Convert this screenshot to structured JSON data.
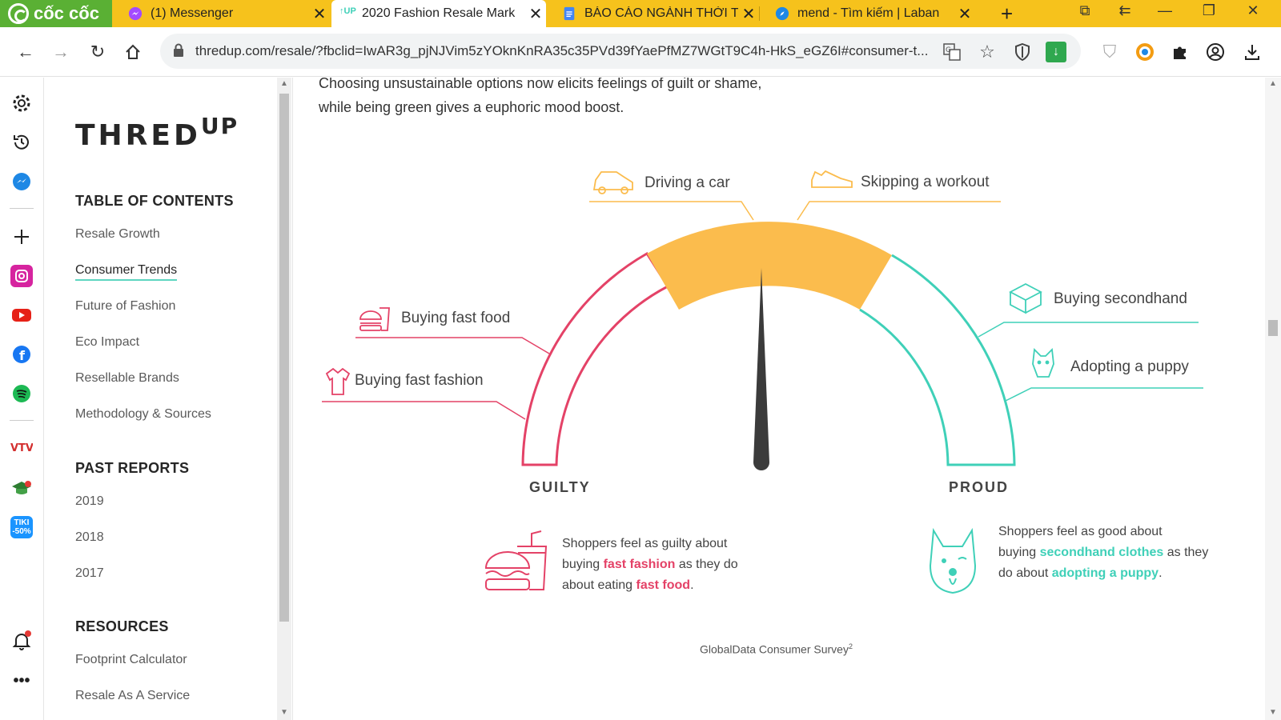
{
  "browser": {
    "brand": "cốc cốc",
    "tabs": [
      {
        "title": "(1) Messenger",
        "icon": "messenger-icon"
      },
      {
        "title": "2020 Fashion Resale Mark",
        "icon": "thredup-icon"
      },
      {
        "title": "BÁO CÁO NGÀNH THỜI T",
        "icon": "google-docs-icon"
      },
      {
        "title": "mend - Tìm kiếm | Laban",
        "icon": "compass-icon"
      }
    ],
    "url": "thredup.com/resale/?fbclid=IwAR3g_pjNJVim5zYOknKnRA35c35PVd39fYaePfMZ7WGtT9C4h-HkS_eGZ6I#consumer-t..."
  },
  "sidebar_icons": [
    "settings-icon",
    "history-icon",
    "messenger-icon",
    "add-icon",
    "instagram-icon",
    "youtube-icon",
    "facebook-icon",
    "spotify-icon",
    "vtv-icon",
    "graduation-icon",
    "tiki-icon",
    "notification-icon",
    "more-icon"
  ],
  "toc": {
    "logo": {
      "main": "THRED",
      "sup": "UP"
    },
    "headings": {
      "contents": "TABLE OF CONTENTS",
      "past": "PAST REPORTS",
      "resources": "RESOURCES"
    },
    "contents": [
      "Resale Growth",
      "Consumer Trends",
      "Future of Fashion",
      "Eco Impact",
      "Resellable Brands",
      "Methodology & Sources"
    ],
    "past": [
      "2019",
      "2018",
      "2017"
    ],
    "resources": [
      "Footprint Calculator",
      "Resale As A Service"
    ],
    "active": "Consumer Trends"
  },
  "main": {
    "intro_line1": "Choosing unsustainable options now elicits feelings of guilt or shame,",
    "intro_line2": "while being green gives a euphoric mood boost.",
    "labels": {
      "car": "Driving a car",
      "workout": "Skipping a workout",
      "fastfood": "Buying fast food",
      "fastfashion": "Buying fast fashion",
      "secondhand": "Buying secondhand",
      "puppy": "Adopting a puppy"
    },
    "axis": {
      "left": "GUILTY",
      "right": "PROUD"
    },
    "note_left": {
      "l1": "Shoppers feel as guilty about",
      "l2a": "buying ",
      "l2b": "fast fashion",
      "l2c": " as they do",
      "l3a": "about eating ",
      "l3b": "fast food",
      "l3c": "."
    },
    "note_right": {
      "l1": "Shoppers feel as good about",
      "l2a": "buying ",
      "l2b": "secondhand clothes",
      "l2c": " as they",
      "l3a": "do about ",
      "l3b": "adopting a puppy",
      "l3c": "."
    },
    "source": "GlobalData Consumer Survey",
    "source_ref": "2"
  },
  "colors": {
    "pink": "#e44267",
    "orange": "#fbbc4d",
    "teal": "#3fd0b8",
    "needle": "#3b3b3b"
  }
}
